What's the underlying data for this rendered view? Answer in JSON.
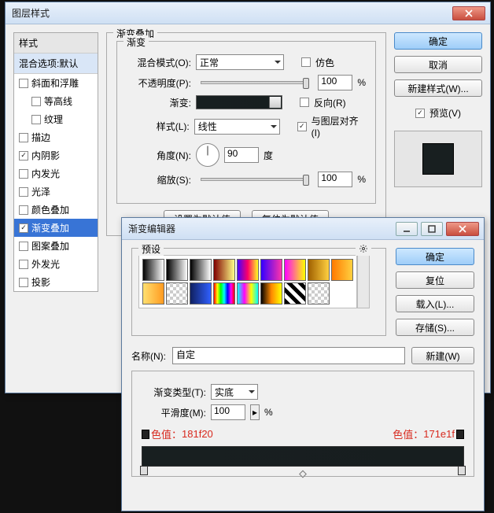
{
  "layerStyle": {
    "title": "图层样式",
    "styles_head": "样式",
    "blend_default": "混合选项:默认",
    "items": [
      {
        "label": "斜面和浮雕",
        "checked": false
      },
      {
        "label": "等高线",
        "checked": false,
        "indent": true
      },
      {
        "label": "纹理",
        "checked": false,
        "indent": true
      },
      {
        "label": "描边",
        "checked": false
      },
      {
        "label": "内阴影",
        "checked": true
      },
      {
        "label": "内发光",
        "checked": false
      },
      {
        "label": "光泽",
        "checked": false
      },
      {
        "label": "颜色叠加",
        "checked": false
      },
      {
        "label": "渐变叠加",
        "checked": true,
        "selected": true
      },
      {
        "label": "图案叠加",
        "checked": false
      },
      {
        "label": "外发光",
        "checked": false
      },
      {
        "label": "投影",
        "checked": false
      }
    ],
    "group_title": "渐变叠加",
    "inner_title": "渐变",
    "blendmode_label": "混合模式(O):",
    "blendmode_value": "正常",
    "dither_label": "仿色",
    "opacity_label": "不透明度(P):",
    "opacity_value": "100",
    "opacity_pct": "%",
    "gradient_label": "渐变:",
    "reverse_label": "反向(R)",
    "style_label": "样式(L):",
    "style_value": "线性",
    "align_label": "与图层对齐(I)",
    "angle_label": "角度(N):",
    "angle_value": "90",
    "angle_unit": "度",
    "scale_label": "缩放(S):",
    "scale_value": "100",
    "scale_pct": "%",
    "set_default": "设置为默认值",
    "reset_default": "复位为默认值",
    "ok": "确定",
    "cancel": "取消",
    "newstyle": "新建样式(W)...",
    "preview_label": "预览(V)"
  },
  "gradEditor": {
    "title": "渐变编辑器",
    "preset_label": "预设",
    "ok": "确定",
    "reset": "复位",
    "load": "载入(L)...",
    "save": "存储(S)...",
    "name_label": "名称(N):",
    "name_value": "自定",
    "new_btn": "新建(W)",
    "type_label": "渐变类型(T):",
    "type_value": "实底",
    "smooth_label": "平滑度(M):",
    "smooth_value": "100",
    "smooth_pct": "%",
    "color1_label": "色值：",
    "color1_value": "181f20",
    "color2_label": "色值：",
    "color2_value": "171e1f",
    "presets_css": [
      "linear-gradient(90deg,#000,#fff)",
      "linear-gradient(90deg,#000,transparent)",
      "linear-gradient(90deg,#000,#fff)",
      "linear-gradient(90deg,#800000,#ff8)",
      "linear-gradient(90deg,#40f,#f06,#ff2)",
      "linear-gradient(90deg,#30f,#f3a)",
      "linear-gradient(90deg,#f0f,#ff0)",
      "linear-gradient(90deg,#a06000,#ffd040)",
      "linear-gradient(90deg,#ff7a00,#ffd040)",
      "linear-gradient(90deg,#ffe070,#ff9a20)",
      "repeating-conic-gradient(#ccc 0 25%,#fff 0 50%) 0/8px 8px",
      "linear-gradient(90deg,#102060,#3060ff)",
      "linear-gradient(90deg,#f00,#ff0,#0f0,#0ff,#00f,#f0f,#f00)",
      "linear-gradient(90deg,#0ff,#f0f,#ff0,#0ff)",
      "linear-gradient(90deg,#000,#f80,#ff0)",
      "repeating-linear-gradient(45deg,#000 0 5px,#fff 5px 10px)",
      "repeating-conic-gradient(#ccc 0 25%,#fff 0 50%) 0/8px 8px"
    ]
  }
}
